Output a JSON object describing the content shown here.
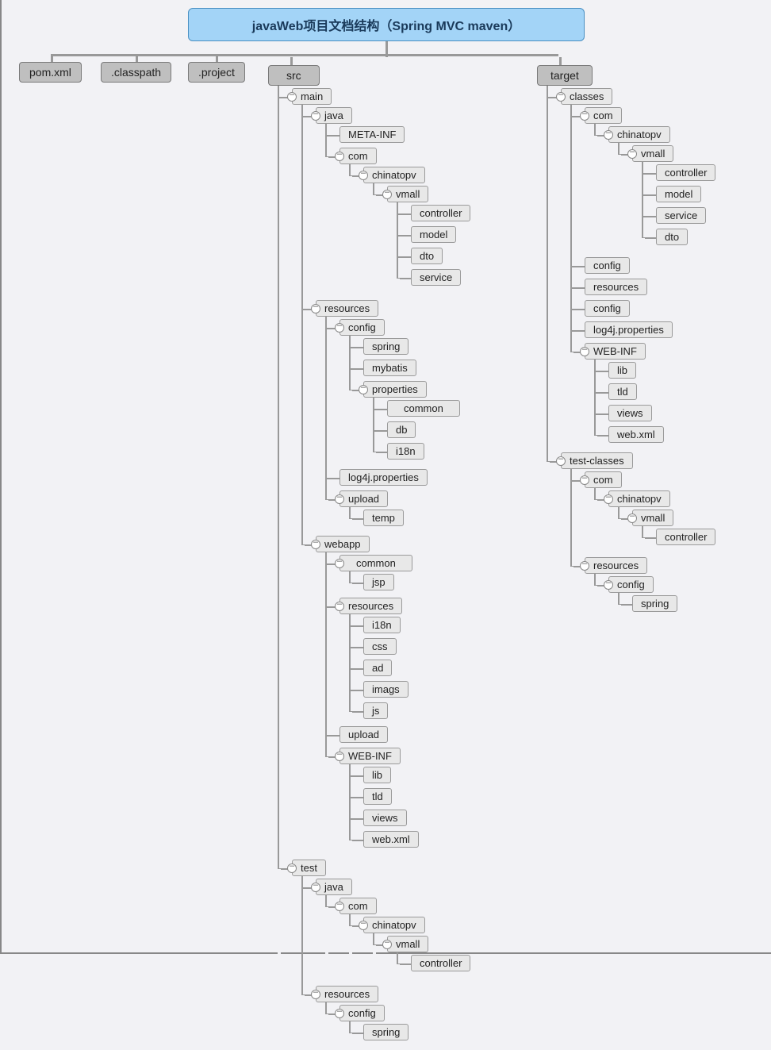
{
  "title": "javaWeb项目文档结构（Spring MVC maven）",
  "top": {
    "pom": "pom.xml",
    "classpath": ".classpath",
    "project": ".project",
    "src": "src",
    "target": "target"
  },
  "src": {
    "main": {
      "label": "main",
      "java": {
        "label": "java",
        "metainf": "META-INF",
        "com": {
          "label": "com",
          "chinatopv": {
            "label": "chinatopv",
            "vmall": {
              "label": "vmall",
              "controller": "controller",
              "model": "model",
              "dto": "dto",
              "service": "service"
            }
          }
        }
      },
      "resources": {
        "label": "resources",
        "config": {
          "label": "config",
          "spring": "spring",
          "mybatis": "mybatis",
          "properties": {
            "label": "properties",
            "common": "common",
            "db": "db",
            "i18n": "i18n"
          }
        },
        "log4j": "log4j.properties",
        "upload": {
          "label": "upload",
          "temp": "temp"
        }
      },
      "webapp": {
        "label": "webapp",
        "common": {
          "label": "common",
          "jsp": "jsp"
        },
        "resources": {
          "label": "resources",
          "i18n": "i18n",
          "css": "css",
          "ad": "ad",
          "imags": "imags",
          "js": "js"
        },
        "upload": "upload",
        "webinf": {
          "label": "WEB-INF",
          "lib": "lib",
          "tld": "tld",
          "views": "views",
          "webxml": "web.xml"
        }
      }
    },
    "test": {
      "label": "test",
      "java": {
        "label": "java",
        "com": {
          "label": "com",
          "chinatopv": {
            "label": "chinatopv",
            "vmall": {
              "label": "vmall",
              "controller": "controller"
            }
          }
        }
      },
      "resources": {
        "label": "resources",
        "config": {
          "label": "config",
          "spring": "spring"
        }
      }
    }
  },
  "target": {
    "classes": {
      "label": "classes",
      "com": {
        "label": "com",
        "chinatopv": {
          "label": "chinatopv",
          "vmall": {
            "label": "vmall",
            "controller": "controller",
            "model": "model",
            "service": "service",
            "dto": "dto"
          }
        }
      },
      "config1": "config",
      "resources": "resources",
      "config2": "config",
      "log4j": "log4j.properties",
      "webinf": {
        "label": "WEB-INF",
        "lib": "lib",
        "tld": "tld",
        "views": "views",
        "webxml": "web.xml"
      }
    },
    "testclasses": {
      "label": "test-classes",
      "com": {
        "label": "com",
        "chinatopv": {
          "label": "chinatopv",
          "vmall": {
            "label": "vmall",
            "controller": "controller"
          }
        }
      },
      "resources": {
        "label": "resources",
        "config": {
          "label": "config",
          "spring": "spring"
        }
      }
    }
  }
}
